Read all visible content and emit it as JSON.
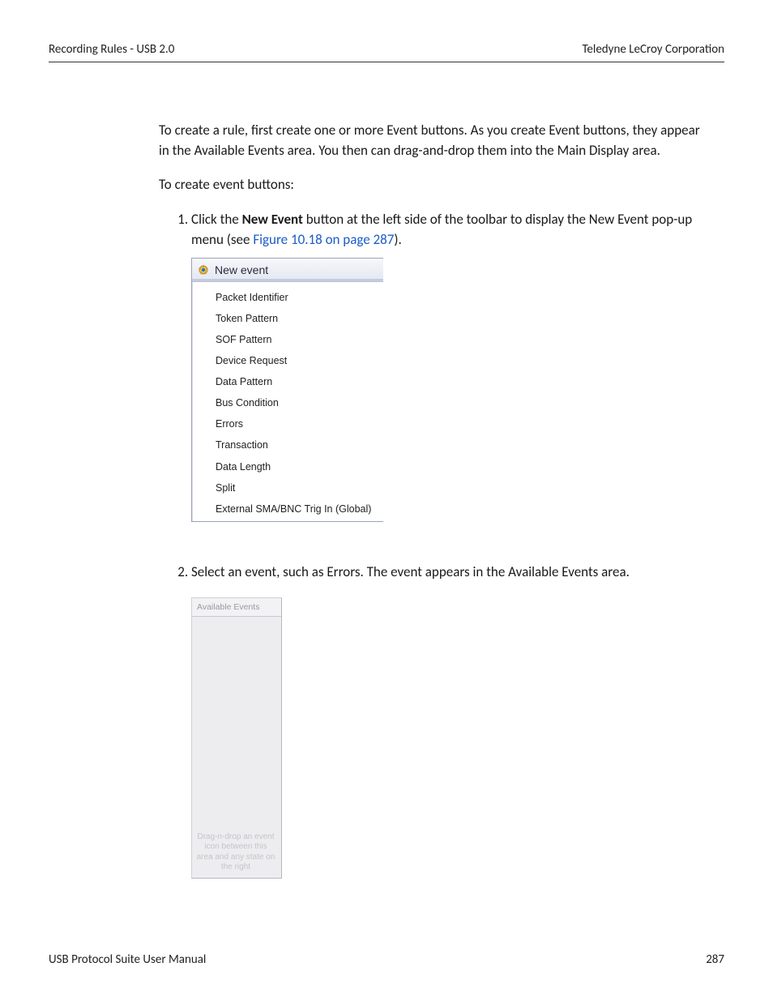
{
  "header": {
    "left": "Recording Rules - USB 2.0",
    "right": "Teledyne LeCroy Corporation"
  },
  "body": {
    "intro": "To create a rule, first create one or more Event buttons. As you create Event buttons, they appear in the Available Events area. You then can drag-and-drop them into the Main Display area.",
    "lead": "To create event buttons:",
    "step1": {
      "before_bold": "Click the ",
      "bold": "New Event",
      "after_bold": " button at the left side of the toolbar to display the New Event pop-up menu (see ",
      "link": "Figure 10.18 on page 287",
      "after_link": ")."
    },
    "step2": "Select an event, such as Errors. The event appears in the Available Events area."
  },
  "newevent": {
    "title": "New event",
    "items": [
      "Packet Identifier",
      "Token Pattern",
      "SOF Pattern",
      "Device Request",
      "Data Pattern",
      "Bus Condition",
      "Errors",
      "Transaction",
      "Data Length",
      "Split",
      "External SMA/BNC Trig In (Global)"
    ]
  },
  "available": {
    "title": "Available Events",
    "hint": "Drag-n-drop an event icon between this area and any state on the right"
  },
  "footer": {
    "left": "USB Protocol Suite User Manual",
    "right": "287"
  }
}
